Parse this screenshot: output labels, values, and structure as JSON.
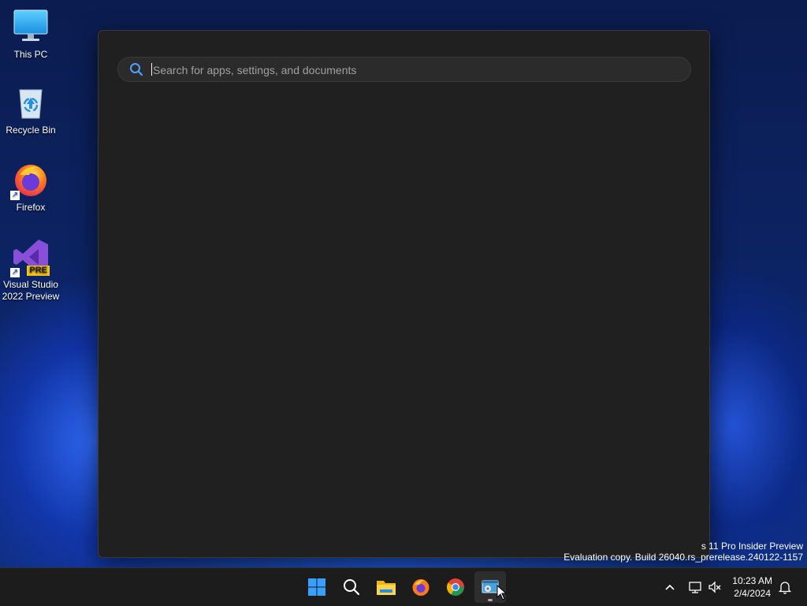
{
  "desktop": {
    "icons": [
      {
        "label": "This PC"
      },
      {
        "label": "Recycle Bin"
      },
      {
        "label": "Firefox"
      },
      {
        "label": "Visual Studio 2022 Preview",
        "badge": "PRE"
      }
    ]
  },
  "search_panel": {
    "search": {
      "placeholder": "Search for apps, settings, and documents",
      "value": ""
    }
  },
  "watermark": {
    "line1": "s 11 Pro Insider Preview",
    "line2": "Evaluation copy. Build 26040.rs_prerelease.240122-1157"
  },
  "taskbar": {
    "apps": [
      {
        "name": "start"
      },
      {
        "name": "search"
      },
      {
        "name": "file-explorer"
      },
      {
        "name": "firefox"
      },
      {
        "name": "chrome"
      },
      {
        "name": "control-panel",
        "active": true
      }
    ],
    "clock": {
      "time": "10:23 AM",
      "date": "2/4/2024"
    }
  },
  "colors": {
    "panel_bg": "#202020",
    "taskbar_bg": "#1c1c1c",
    "accent": "#0078d4"
  }
}
